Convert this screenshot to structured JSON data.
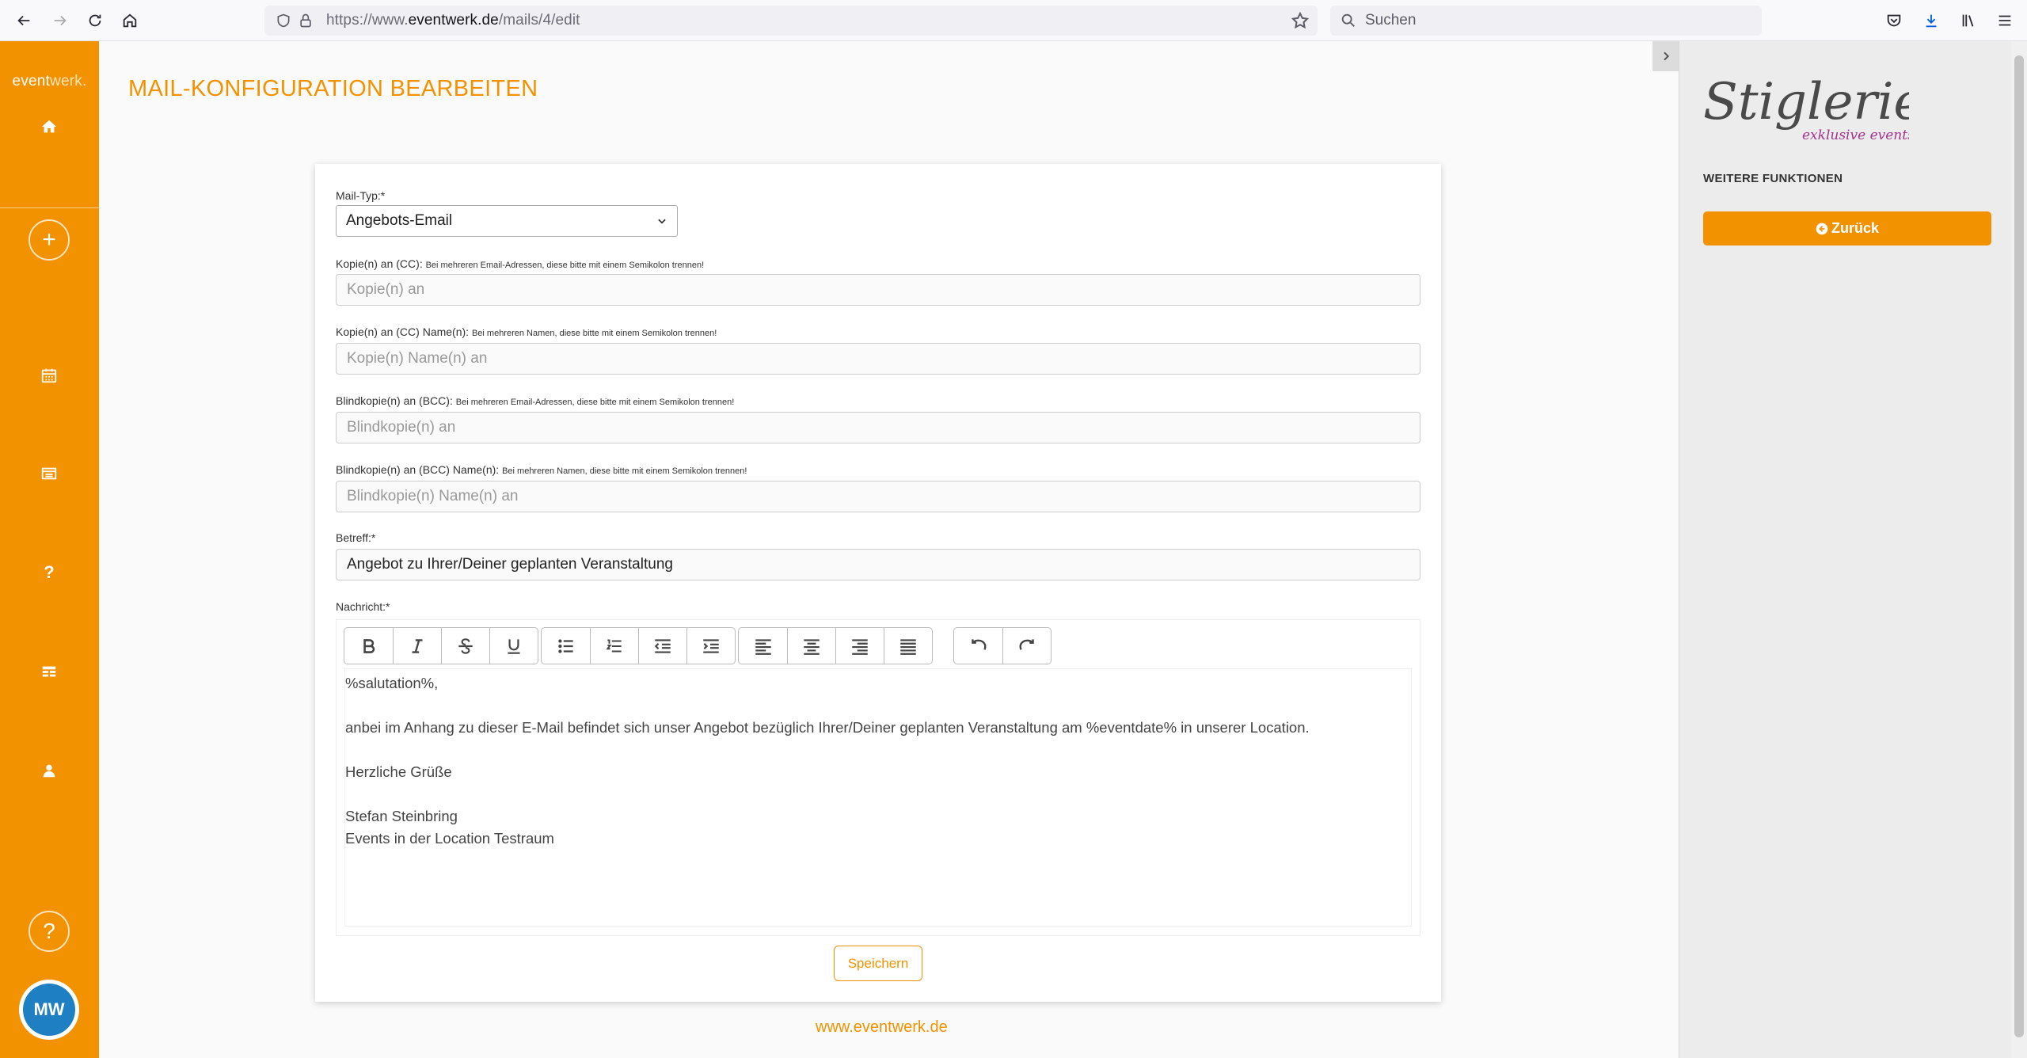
{
  "browser": {
    "url_prefix": "https://www.",
    "url_host": "eventwerk.de",
    "url_path": "/mails/4/edit",
    "search_placeholder": "Suchen"
  },
  "sidebar": {
    "brand_a": "event",
    "brand_b": "werk.",
    "plus": "+",
    "help": "?",
    "avatar_initials": "MW"
  },
  "page": {
    "title": "MAIL-KONFIGURATION BEARBEITEN"
  },
  "form": {
    "mail_type_label": "Mail-Typ:*",
    "mail_type_value": "Angebots-Email",
    "cc_label": "Kopie(n) an (CC):",
    "cc_hint": "Bei mehreren Email-Adressen, diese bitte mit einem Semikolon trennen!",
    "cc_placeholder": "Kopie(n) an",
    "cc_name_label": "Kopie(n) an (CC) Name(n):",
    "cc_name_hint": "Bei mehreren Namen, diese bitte mit einem Semikolon trennen!",
    "cc_name_placeholder": "Kopie(n) Name(n) an",
    "bcc_label": "Blindkopie(n) an (BCC):",
    "bcc_hint": "Bei mehreren Email-Adressen, diese bitte mit einem Semikolon trennen!",
    "bcc_placeholder": "Blindkopie(n) an",
    "bcc_name_label": "Blindkopie(n) an (BCC) Name(n):",
    "bcc_name_hint": "Bei mehreren Namen, diese bitte mit einem Semikolon trennen!",
    "bcc_name_placeholder": "Blindkopie(n) Name(n) an",
    "subject_label": "Betreff:*",
    "subject_value": "Angebot zu Ihrer/Deiner geplanten Veranstaltung",
    "message_label": "Nachricht:*",
    "message_lines": [
      "%salutation%,",
      "",
      "anbei im Anhang zu dieser E-Mail befindet sich unser Angebot bezüglich Ihrer/Deiner geplanten Veranstaltung am %eventdate% in unserer Location.",
      "",
      "Herzliche Grüße",
      "",
      "Stefan Steinbring",
      "Events in der Location Testraum"
    ],
    "save_label": "Speichern"
  },
  "footer": {
    "link": "www.eventwerk.de"
  },
  "right_panel": {
    "logo_text": "Stiglerie",
    "logo_sub": "exklusive events",
    "heading": "WEITERE FUNKTIONEN",
    "back_label": "Zurück"
  },
  "colors": {
    "accent": "#f39200",
    "logo_sub": "#a0348e"
  }
}
